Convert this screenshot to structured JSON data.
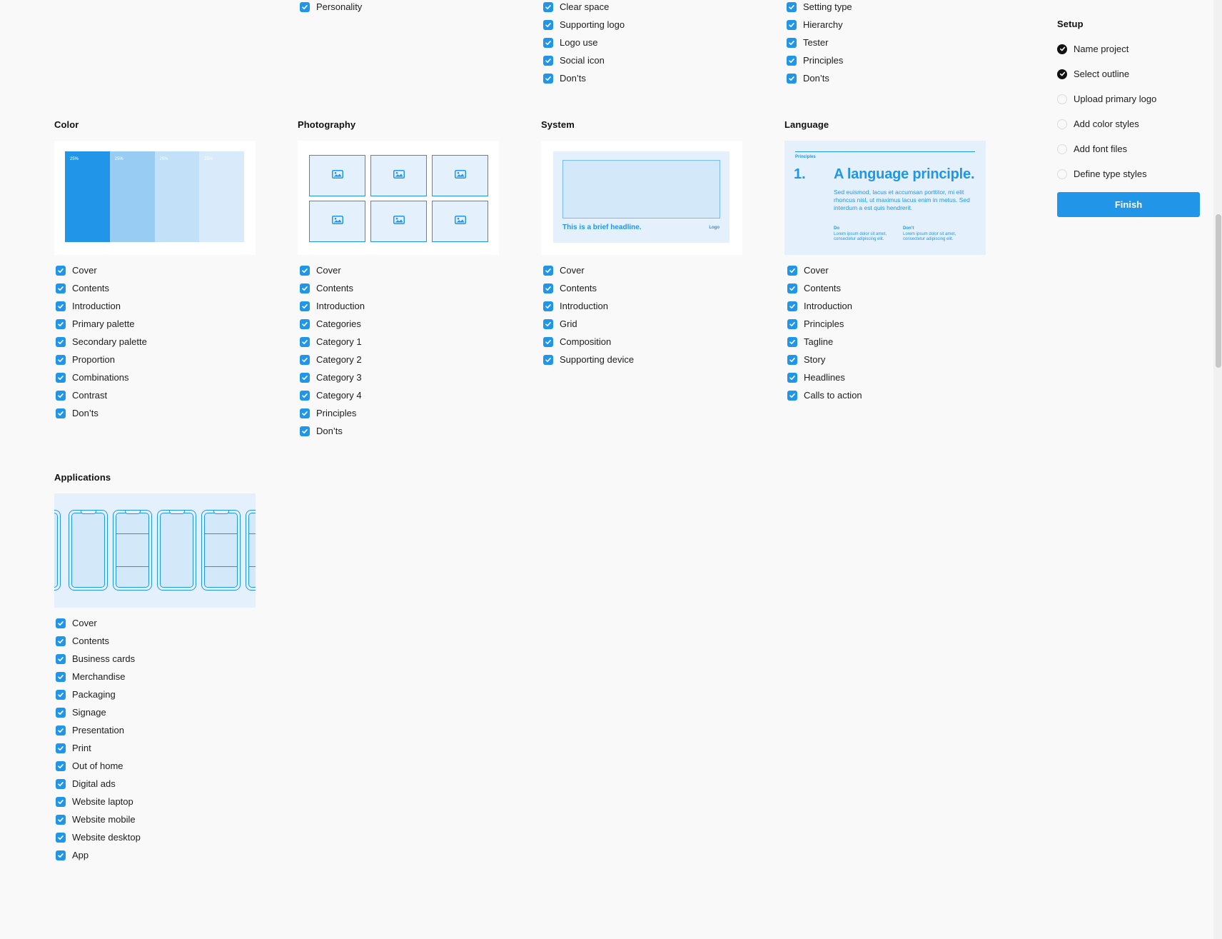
{
  "top_lists": {
    "col1": [
      "Personality"
    ],
    "col2": [
      "Clear space",
      "Supporting logo",
      "Logo use",
      "Social icon",
      "Don’ts"
    ],
    "col3": [
      "Setting type",
      "Hierarchy",
      "Tester",
      "Principles",
      "Don’ts"
    ]
  },
  "sections": {
    "color": {
      "title": "Color",
      "swatches": [
        {
          "label": "25%",
          "color": "#2196e8"
        },
        {
          "label": "25%",
          "color": "#99ccf3"
        },
        {
          "label": "25%",
          "color": "#c2e0f8"
        },
        {
          "label": "25%",
          "color": "#d9ebfa"
        }
      ],
      "items": [
        "Cover",
        "Contents",
        "Introduction",
        "Primary palette",
        "Secondary palette",
        "Proportion",
        "Combinations",
        "Contrast",
        "Don’ts"
      ]
    },
    "photography": {
      "title": "Photography",
      "items": [
        "Cover",
        "Contents",
        "Introduction",
        "Categories",
        "Category 1",
        "Category 2",
        "Category 3",
        "Category 4",
        "Principles",
        "Don’ts"
      ]
    },
    "system": {
      "title": "System",
      "headline": "This is a brief headline.",
      "logo": "Logo",
      "items": [
        "Cover",
        "Contents",
        "Introduction",
        "Grid",
        "Composition",
        "Supporting device"
      ]
    },
    "language": {
      "title": "Language",
      "preview_label": "Principles",
      "preview_number": "1.",
      "preview_title": "A language principle.",
      "preview_body": "Sed euismod, lacus et accumsan porttitor, mi elit rhoncus nisl, ut maximus lacus enim in metus. Sed interdum a est quis hendrerit.",
      "do_label": "Do",
      "do_text": "Lorem ipsum dolor sit amet, consectetur adipiscing elit.",
      "dont_label": "Don’t",
      "dont_text": "Lorem ipsum dolor sit amet, consectetur adipiscing elit.",
      "items": [
        "Cover",
        "Contents",
        "Introduction",
        "Principles",
        "Tagline",
        "Story",
        "Headlines",
        "Calls to action"
      ]
    },
    "applications": {
      "title": "Applications",
      "items": [
        "Cover",
        "Contents",
        "Business cards",
        "Merchandise",
        "Packaging",
        "Signage",
        "Presentation",
        "Print",
        "Out of home",
        "Digital ads",
        "Website laptop",
        "Website mobile",
        "Website desktop",
        "App"
      ]
    }
  },
  "setup": {
    "title": "Setup",
    "steps": [
      {
        "label": "Name project",
        "done": true
      },
      {
        "label": "Select outline",
        "done": true
      },
      {
        "label": "Upload primary logo",
        "done": false
      },
      {
        "label": "Add color styles",
        "done": false
      },
      {
        "label": "Add font files",
        "done": false
      },
      {
        "label": "Define type styles",
        "done": false
      }
    ],
    "finish_label": "Finish"
  },
  "colors": {
    "accent": "#2196e8",
    "pale": "#e4f1fc"
  },
  "icons": {
    "checkbox": "checkbox-checked-icon",
    "step_done": "check-circle-icon",
    "step_todo": "empty-circle-icon",
    "photo": "image-placeholder-icon"
  }
}
